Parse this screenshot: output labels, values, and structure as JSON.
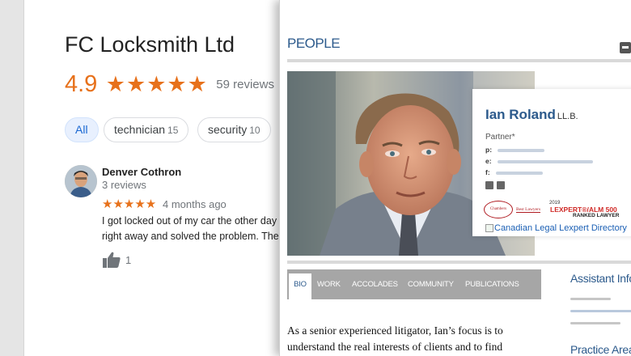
{
  "business": {
    "name": "FC Locksmith Ltd",
    "rating": "4.9",
    "stars": "★★★★★",
    "review_count": "59 reviews"
  },
  "filter_chips": [
    {
      "label": "All",
      "count": ""
    },
    {
      "label": "technician",
      "count": "15"
    },
    {
      "label": "security",
      "count": "10"
    }
  ],
  "review": {
    "author": "Denver Cothron",
    "author_meta": "3 reviews",
    "stars": "★★★★★",
    "time": "4 months ago",
    "text_line1": "I got locked out of my car the other day",
    "text_line2": "right away and solved the problem. The",
    "likes": "1"
  },
  "profile": {
    "section_title": "PEOPLE",
    "name": "Ian Roland",
    "suffix": "LL.B.",
    "title": "Partner*",
    "contact_labels": [
      "p:",
      "e:",
      "f:"
    ],
    "award_year": "2019",
    "award_lexpert": "LEXPERT®/ALM 500",
    "award_ranked": "RANKED LAWYER",
    "award_chambers": "Chambers",
    "award_best": "Best Lawyers",
    "directory_link": "Canadian Legal Lexpert Directory",
    "tabs": [
      "BIO",
      "WORK",
      "ACCOLADES",
      "COMMUNITY",
      "PUBLICATIONS"
    ],
    "bio_line1": "As a senior experienced litigator, Ian’s focus is to",
    "bio_line2": "understand the real interests of clients and to find",
    "side_heading1": "Assistant Info",
    "side_heading2": "Practice Area"
  },
  "colors": {
    "star_orange": "#e7711b",
    "brand_blue": "#2c5a8c",
    "chip_active_bg": "#e8f0fe"
  }
}
